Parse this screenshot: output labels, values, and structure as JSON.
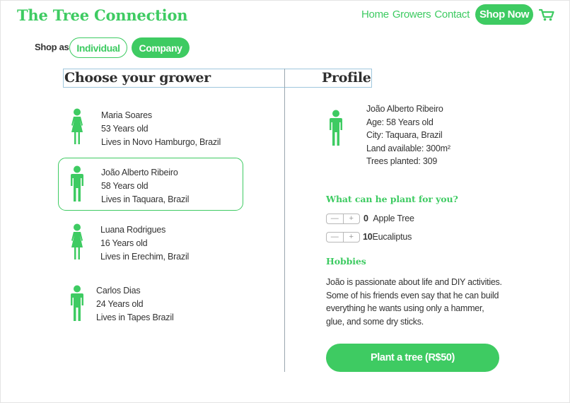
{
  "header": {
    "brand": "The Tree Connection",
    "nav": [
      "Home",
      "Growers",
      "Contact"
    ],
    "shop_now": "Shop Now",
    "cart_icon": "cart-icon"
  },
  "shop_as": {
    "label": "Shop as",
    "options": [
      "Individual",
      "Company"
    ],
    "selected": "Company"
  },
  "headings": {
    "choose": "Choose your grower",
    "profile": "Profile"
  },
  "growers": [
    {
      "name": "Maria Soares",
      "age": "53 Years old",
      "location": "Lives in Novo Hamburgo, Brazil",
      "gender": "female",
      "selected": false
    },
    {
      "name": "João Alberto Ribeiro",
      "age": "58 Years old",
      "location": "Lives in Taquara, Brazil",
      "gender": "male",
      "selected": true
    },
    {
      "name": "Luana Rodrigues",
      "age": "16 Years old",
      "location": "Lives in Erechim, Brazil",
      "gender": "female",
      "selected": false
    },
    {
      "name": "Carlos Dias",
      "age": "24 Years old",
      "location": "Lives in Tapes Brazil",
      "gender": "male",
      "selected": false
    }
  ],
  "profile": {
    "name": "João Alberto Ribeiro",
    "age": "Age: 58 Years old",
    "city": "City: Taquara, Brazil",
    "land": "Land available: 300m²",
    "trees": "Trees planted: 309",
    "plant_heading": "What can he plant for you?",
    "plants": [
      {
        "qty": "0",
        "name": "Apple Tree"
      },
      {
        "qty": "10",
        "name": "Eucaliptus"
      }
    ],
    "hobbies_heading": "Hobbies",
    "hobbies_text": "João is passionate about life and DIY activities. Some of his friends even say that he can build everything he wants using only a hammer, glue, and some dry sticks.",
    "cta": "Plant a tree (R$50)"
  },
  "colors": {
    "accent": "#3ecb62",
    "divider": "#9aa6ae"
  }
}
